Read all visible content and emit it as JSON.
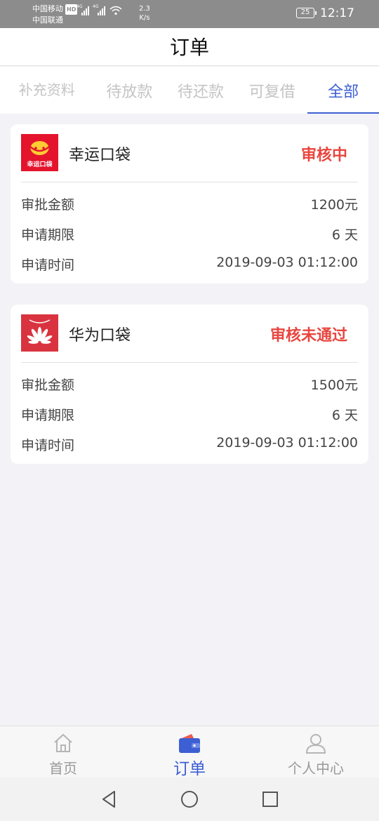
{
  "status_bar": {
    "carrier1": "中国移动",
    "hd": "HD",
    "carrier2": "中国联通",
    "net1": "4G",
    "net2": "4G",
    "speed_value": "2.3",
    "speed_unit": "K/s",
    "battery": "25",
    "time": "12:17"
  },
  "header": {
    "title": "订单"
  },
  "tabs": [
    {
      "label": "补充资料",
      "active": false
    },
    {
      "label": "待放款",
      "active": false
    },
    {
      "label": "待还款",
      "active": false
    },
    {
      "label": "可复借",
      "active": false
    },
    {
      "label": "全部",
      "active": true
    }
  ],
  "orders": [
    {
      "name": "幸运口袋",
      "logo_text": "幸运口袋",
      "status": "审核中",
      "rows": [
        {
          "label": "审批金额",
          "value": "1200元"
        },
        {
          "label": "申请期限",
          "value": "6 天"
        },
        {
          "label": "申请时间",
          "value": "2019-09-03 01:12:00"
        }
      ]
    },
    {
      "name": "华为口袋",
      "status": "审核未通过",
      "rows": [
        {
          "label": "审批金额",
          "value": "1500元"
        },
        {
          "label": "申请期限",
          "value": "6 天"
        },
        {
          "label": "申请时间",
          "value": "2019-09-03 01:12:00"
        }
      ]
    }
  ],
  "bottom_nav": [
    {
      "label": "首页",
      "icon": "home-icon"
    },
    {
      "label": "订单",
      "icon": "wallet-icon"
    },
    {
      "label": "个人中心",
      "icon": "person-icon"
    }
  ],
  "colors": {
    "accent": "#3d5fd4",
    "status_red": "#e8463f",
    "background": "#f2f2f7"
  }
}
